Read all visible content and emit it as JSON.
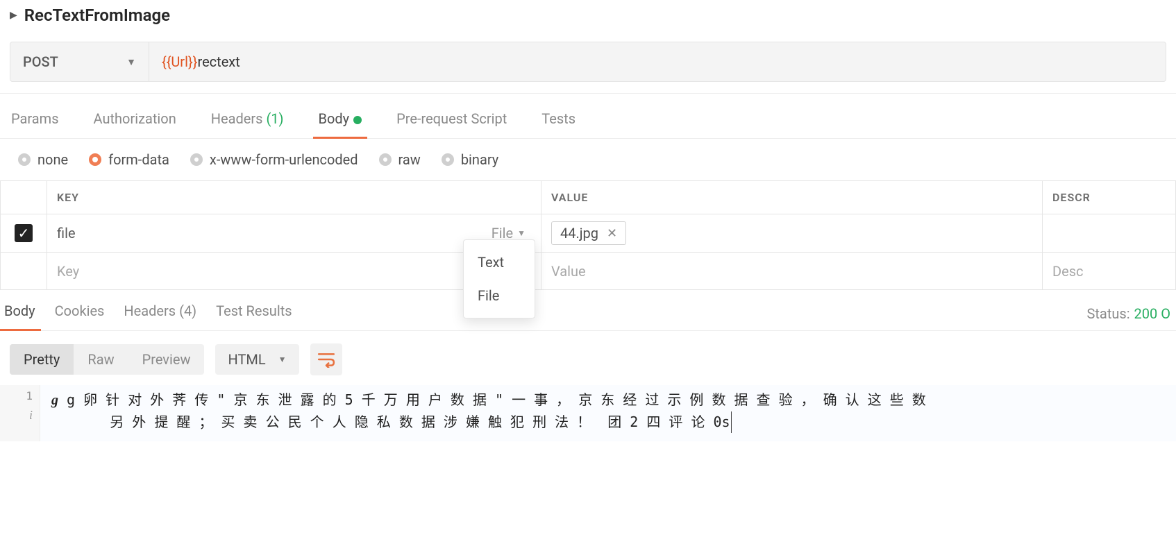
{
  "request": {
    "title": "RecTextFromImage",
    "method": "POST",
    "url_variable": "{{Url}}",
    "url_path": "rectext"
  },
  "tabs": {
    "items": [
      {
        "label": "Params"
      },
      {
        "label": "Authorization"
      },
      {
        "label": "Headers",
        "count": "(1)"
      },
      {
        "label": "Body",
        "indicator": true,
        "active": true
      },
      {
        "label": "Pre-request Script"
      },
      {
        "label": "Tests"
      }
    ]
  },
  "body_type": {
    "options": [
      "none",
      "form-data",
      "x-www-form-urlencoded",
      "raw",
      "binary"
    ],
    "selected": "form-data"
  },
  "kv_table": {
    "headers": {
      "key": "KEY",
      "value": "VALUE",
      "description": "DESCR"
    },
    "rows": [
      {
        "checked": true,
        "key": "file",
        "type": "File",
        "file_name": "44.jpg"
      }
    ],
    "placeholders": {
      "key": "Key",
      "value": "Value",
      "description": "Desc"
    },
    "type_menu": [
      "Text",
      "File"
    ]
  },
  "response": {
    "tabs": [
      {
        "label": "Body",
        "active": true
      },
      {
        "label": "Cookies"
      },
      {
        "label": "Headers",
        "count": "(4)"
      },
      {
        "label": "Test Results"
      }
    ],
    "status_label": "Status:",
    "status_code": "200 O",
    "views": [
      "Pretty",
      "Raw",
      "Preview"
    ],
    "active_view": "Pretty",
    "format": "HTML",
    "line_number": "1",
    "code_line1": "g 卵 针 对 外 荠 传 \" 京 东 泄 露 的 5 千 万 用 户 数 据 \" 一 事 ， 京 东 经 过 示 例 数 据 查 验 ， 确 认 这 些 数",
    "code_line2": "另 外 提 醒 ； 买 卖 公 民 个 人 隐 私 数 据 涉 嫌 触 犯 刑 法 ！  团 2 四 评 论 0s"
  }
}
